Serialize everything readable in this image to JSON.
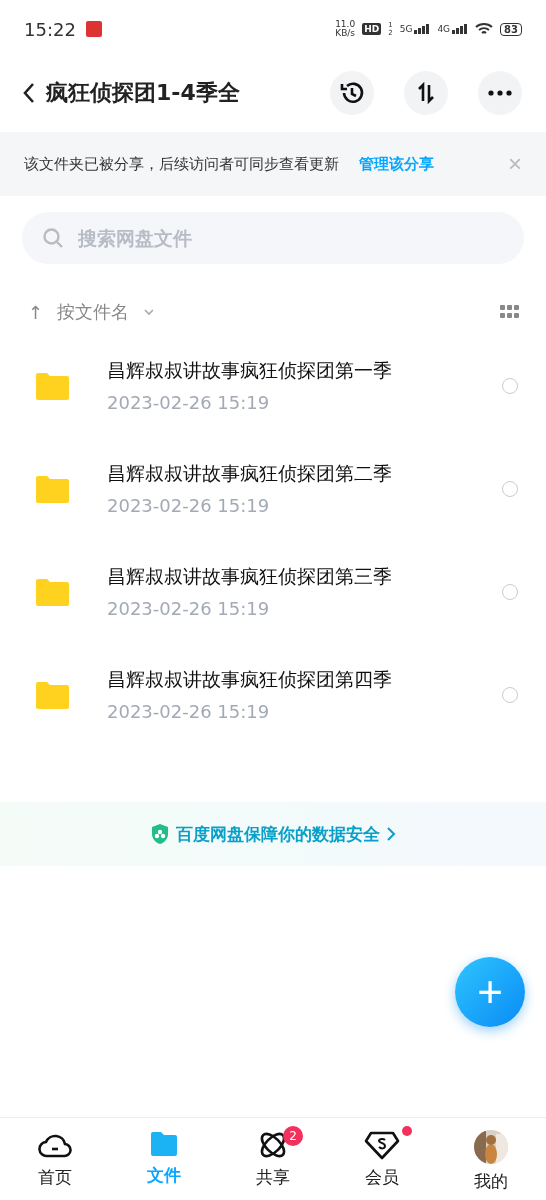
{
  "status_bar": {
    "time": "15:22",
    "speed": "11.0",
    "speed_unit": "KB/s",
    "hd": "HD",
    "hd_sims": [
      "1",
      "2"
    ],
    "networks": [
      "5G",
      "4G"
    ],
    "battery": "83"
  },
  "header": {
    "title": "疯狂侦探团1-4季全"
  },
  "share_notice": {
    "text": "该文件夹已被分享，后续访问者可同步查看更新",
    "link": "管理该分享",
    "close": "×"
  },
  "search": {
    "placeholder": "搜索网盘文件"
  },
  "sort": {
    "arrow": "↑",
    "label": "按文件名"
  },
  "files": [
    {
      "name": "昌辉叔叔讲故事疯狂侦探团第一季",
      "date": "2023-02-26  15:19",
      "selected": false
    },
    {
      "name": "昌辉叔叔讲故事疯狂侦探团第二季",
      "date": "2023-02-26  15:19",
      "selected": false
    },
    {
      "name": "昌辉叔叔讲故事疯狂侦探团第三季",
      "date": "2023-02-26  15:19",
      "selected": false
    },
    {
      "name": "昌辉叔叔讲故事疯狂侦探团第四季",
      "date": "2023-02-26  15:19",
      "selected": false
    }
  ],
  "security": {
    "text": "百度网盘保障你的数据安全"
  },
  "fab": {
    "label": "+"
  },
  "tabs": [
    {
      "kind": "cloud",
      "label": "首页",
      "selected": false
    },
    {
      "kind": "folder",
      "label": "文件",
      "selected": true
    },
    {
      "kind": "atom",
      "label": "共享",
      "selected": false,
      "badge": "2"
    },
    {
      "kind": "diamond",
      "label": "会员",
      "selected": false,
      "dot": true
    },
    {
      "kind": "avatar",
      "label": "我的",
      "selected": false
    }
  ]
}
